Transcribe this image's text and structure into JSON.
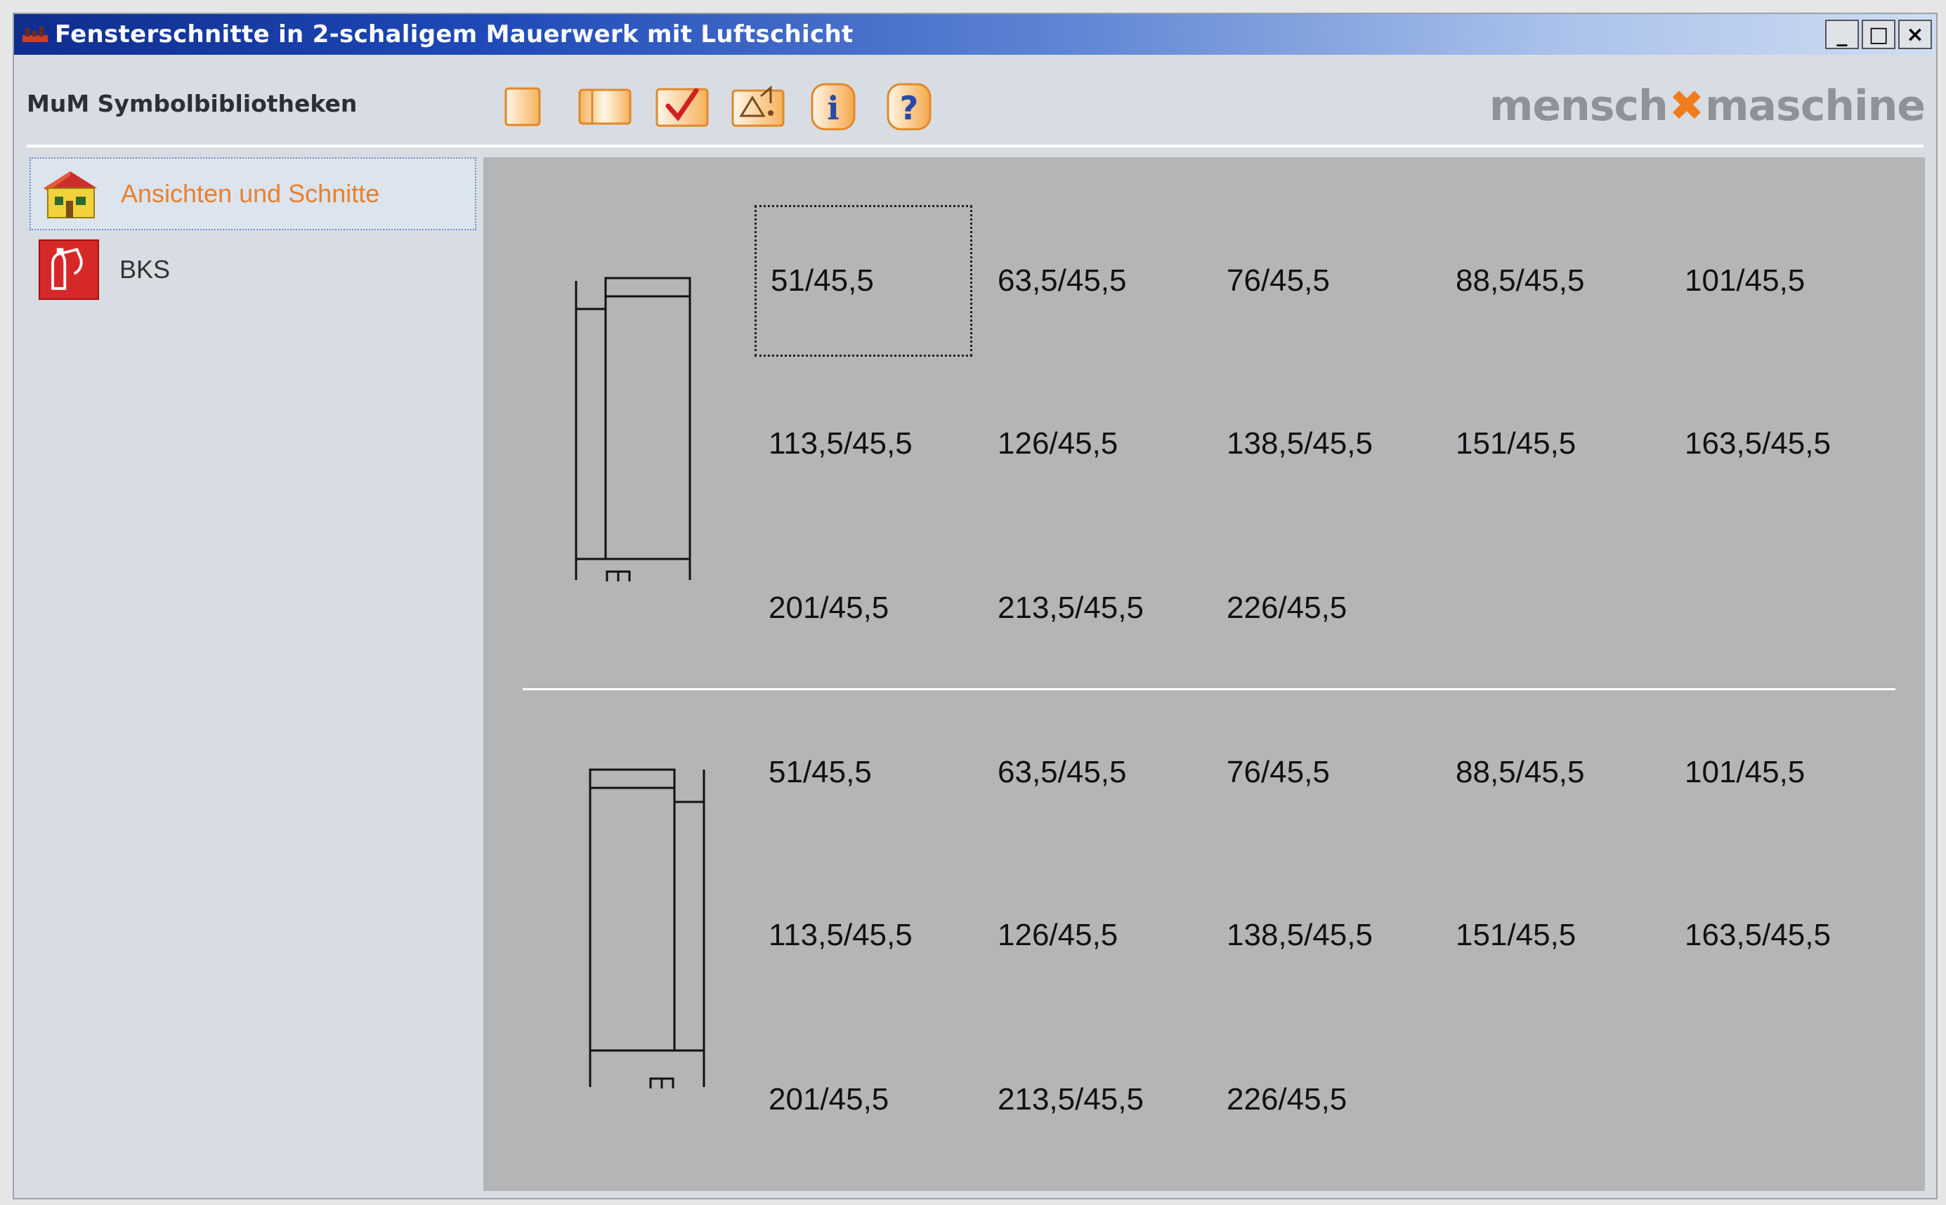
{
  "window": {
    "title": "Fensterschnitte in 2-schaligem Mauerwerk mit Luftschicht",
    "controls": [
      "_",
      "□",
      "×"
    ]
  },
  "toolbar": {
    "label": "MuM Symbolbibliotheken",
    "buttons": [
      {
        "name": "single-panel-icon"
      },
      {
        "name": "double-panel-icon"
      },
      {
        "name": "checkmark-icon"
      },
      {
        "name": "insert-icon"
      },
      {
        "name": "info-icon",
        "glyph": "i"
      },
      {
        "name": "help-icon",
        "glyph": "?"
      }
    ],
    "brand_left": "mensch",
    "brand_mark": "✖",
    "brand_right": "maschine"
  },
  "sidebar": {
    "items": [
      {
        "label": "Ansichten und Schnitte",
        "icon": "house-icon",
        "selected": true,
        "color": "#e8802e"
      },
      {
        "label": "BKS",
        "icon": "fire-extinguisher-icon",
        "selected": false,
        "color": "#333333"
      }
    ]
  },
  "content": {
    "sections": [
      {
        "symbol": "window-section-left-icon",
        "rows": [
          [
            "51/45,5",
            "63,5/45,5",
            "76/45,5",
            "88,5/45,5",
            "101/45,5"
          ],
          [
            "113,5/45,5",
            "126/45,5",
            "138,5/45,5",
            "151/45,5",
            "163,5/45,5"
          ],
          [
            "201/45,5",
            "213,5/45,5",
            "226/45,5"
          ]
        ]
      },
      {
        "symbol": "window-section-right-icon",
        "rows": [
          [
            "51/45,5",
            "63,5/45,5",
            "76/45,5",
            "88,5/45,5",
            "101/45,5"
          ],
          [
            "113,5/45,5",
            "126/45,5",
            "138,5/45,5",
            "151/45,5",
            "163,5/45,5"
          ],
          [
            "201/45,5",
            "213,5/45,5",
            "226/45,5"
          ]
        ]
      }
    ]
  }
}
